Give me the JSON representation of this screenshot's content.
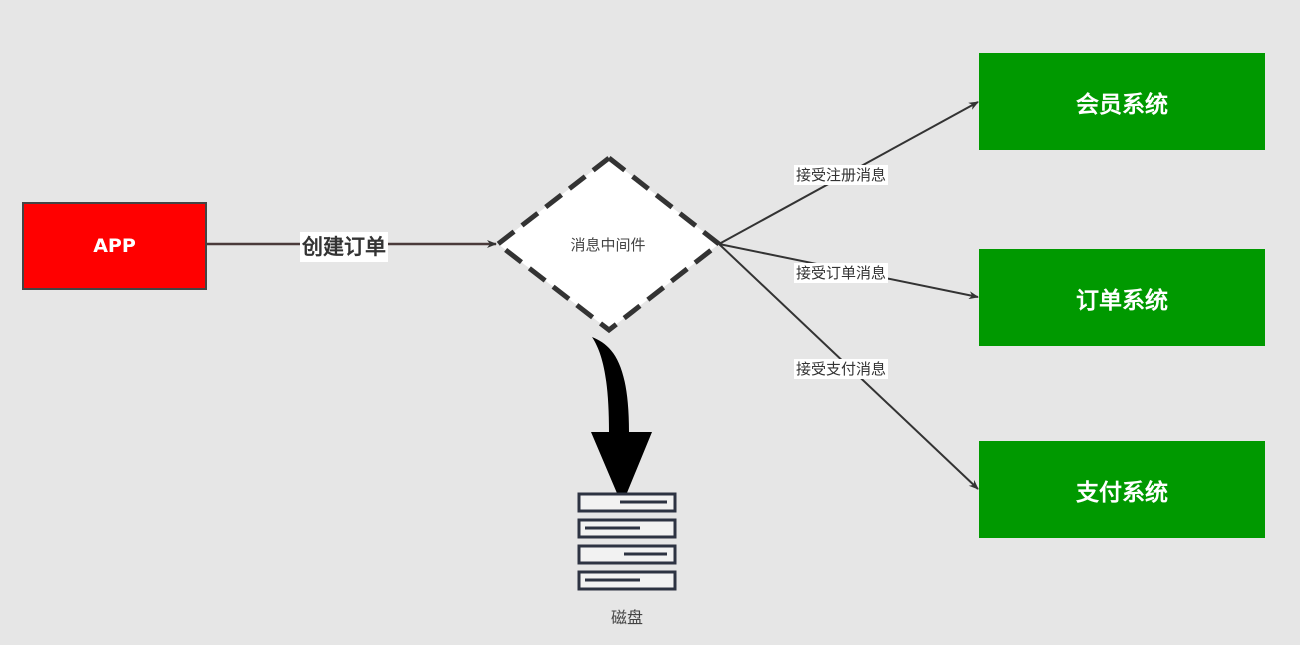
{
  "diagram": {
    "source_node": {
      "label": "APP",
      "fill": "#ff0000"
    },
    "middleware_node": {
      "label": "消息中间件",
      "fill": "#ffffff",
      "border": "#333333"
    },
    "storage_node": {
      "label": "磁盘"
    },
    "target_nodes": [
      {
        "label": "会员系统",
        "fill": "#009900"
      },
      {
        "label": "订单系统",
        "fill": "#009900"
      },
      {
        "label": "支付系统",
        "fill": "#009900"
      }
    ],
    "edges": [
      {
        "from": "APP",
        "to": "消息中间件",
        "label": "创建订单"
      },
      {
        "from": "消息中间件",
        "to": "会员系统",
        "label": "接受注册消息"
      },
      {
        "from": "消息中间件",
        "to": "订单系统",
        "label": "接受订单消息"
      },
      {
        "from": "消息中间件",
        "to": "支付系统",
        "label": "接受支付消息"
      },
      {
        "from": "消息中间件",
        "to": "磁盘",
        "label": ""
      }
    ]
  }
}
